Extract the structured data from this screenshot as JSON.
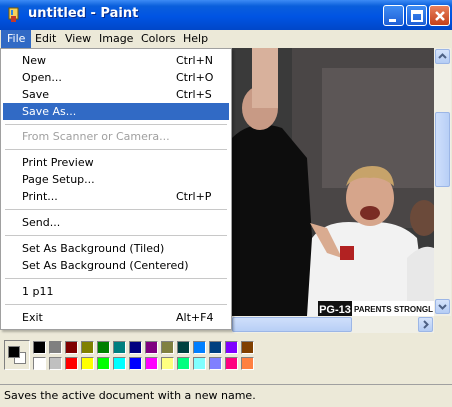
{
  "window": {
    "title": "untitled - Paint"
  },
  "menubar": {
    "items": [
      "File",
      "Edit",
      "View",
      "Image",
      "Colors",
      "Help"
    ]
  },
  "file_menu": {
    "items": [
      {
        "label": "New",
        "shortcut": "Ctrl+N"
      },
      {
        "label": "Open...",
        "shortcut": "Ctrl+O"
      },
      {
        "label": "Save",
        "shortcut": "Ctrl+S"
      },
      {
        "label": "Save As...",
        "shortcut": ""
      },
      {
        "label": "From Scanner or Camera...",
        "shortcut": ""
      },
      {
        "label": "Print Preview",
        "shortcut": ""
      },
      {
        "label": "Page Setup...",
        "shortcut": ""
      },
      {
        "label": "Print...",
        "shortcut": "Ctrl+P"
      },
      {
        "label": "Send...",
        "shortcut": ""
      },
      {
        "label": "Set As Background (Tiled)",
        "shortcut": ""
      },
      {
        "label": "Set As Background (Centered)",
        "shortcut": ""
      },
      {
        "label": "1 p11",
        "shortcut": ""
      },
      {
        "label": "Exit",
        "shortcut": "Alt+F4"
      }
    ],
    "highlighted": "Save As...",
    "disabled": [
      "From Scanner or Camera..."
    ]
  },
  "image_overlay": {
    "rating": "PG-13",
    "rating_text": "PARENTS STRONGL"
  },
  "palette": {
    "foreground": "#000000",
    "background": "#ffffff",
    "colors_top": [
      "#000000",
      "#808080",
      "#800000",
      "#808000",
      "#008000",
      "#008080",
      "#000080",
      "#800080",
      "#808040",
      "#004040",
      "#0080ff",
      "#004080",
      "#8000ff",
      "#804000"
    ],
    "colors_bottom": [
      "#ffffff",
      "#c0c0c0",
      "#ff0000",
      "#ffff00",
      "#00ff00",
      "#00ffff",
      "#0000ff",
      "#ff00ff",
      "#ffff80",
      "#00ff80",
      "#80ffff",
      "#8080ff",
      "#ff0080",
      "#ff8040"
    ]
  },
  "statusbar": {
    "text": "Saves the active document with a new name."
  }
}
